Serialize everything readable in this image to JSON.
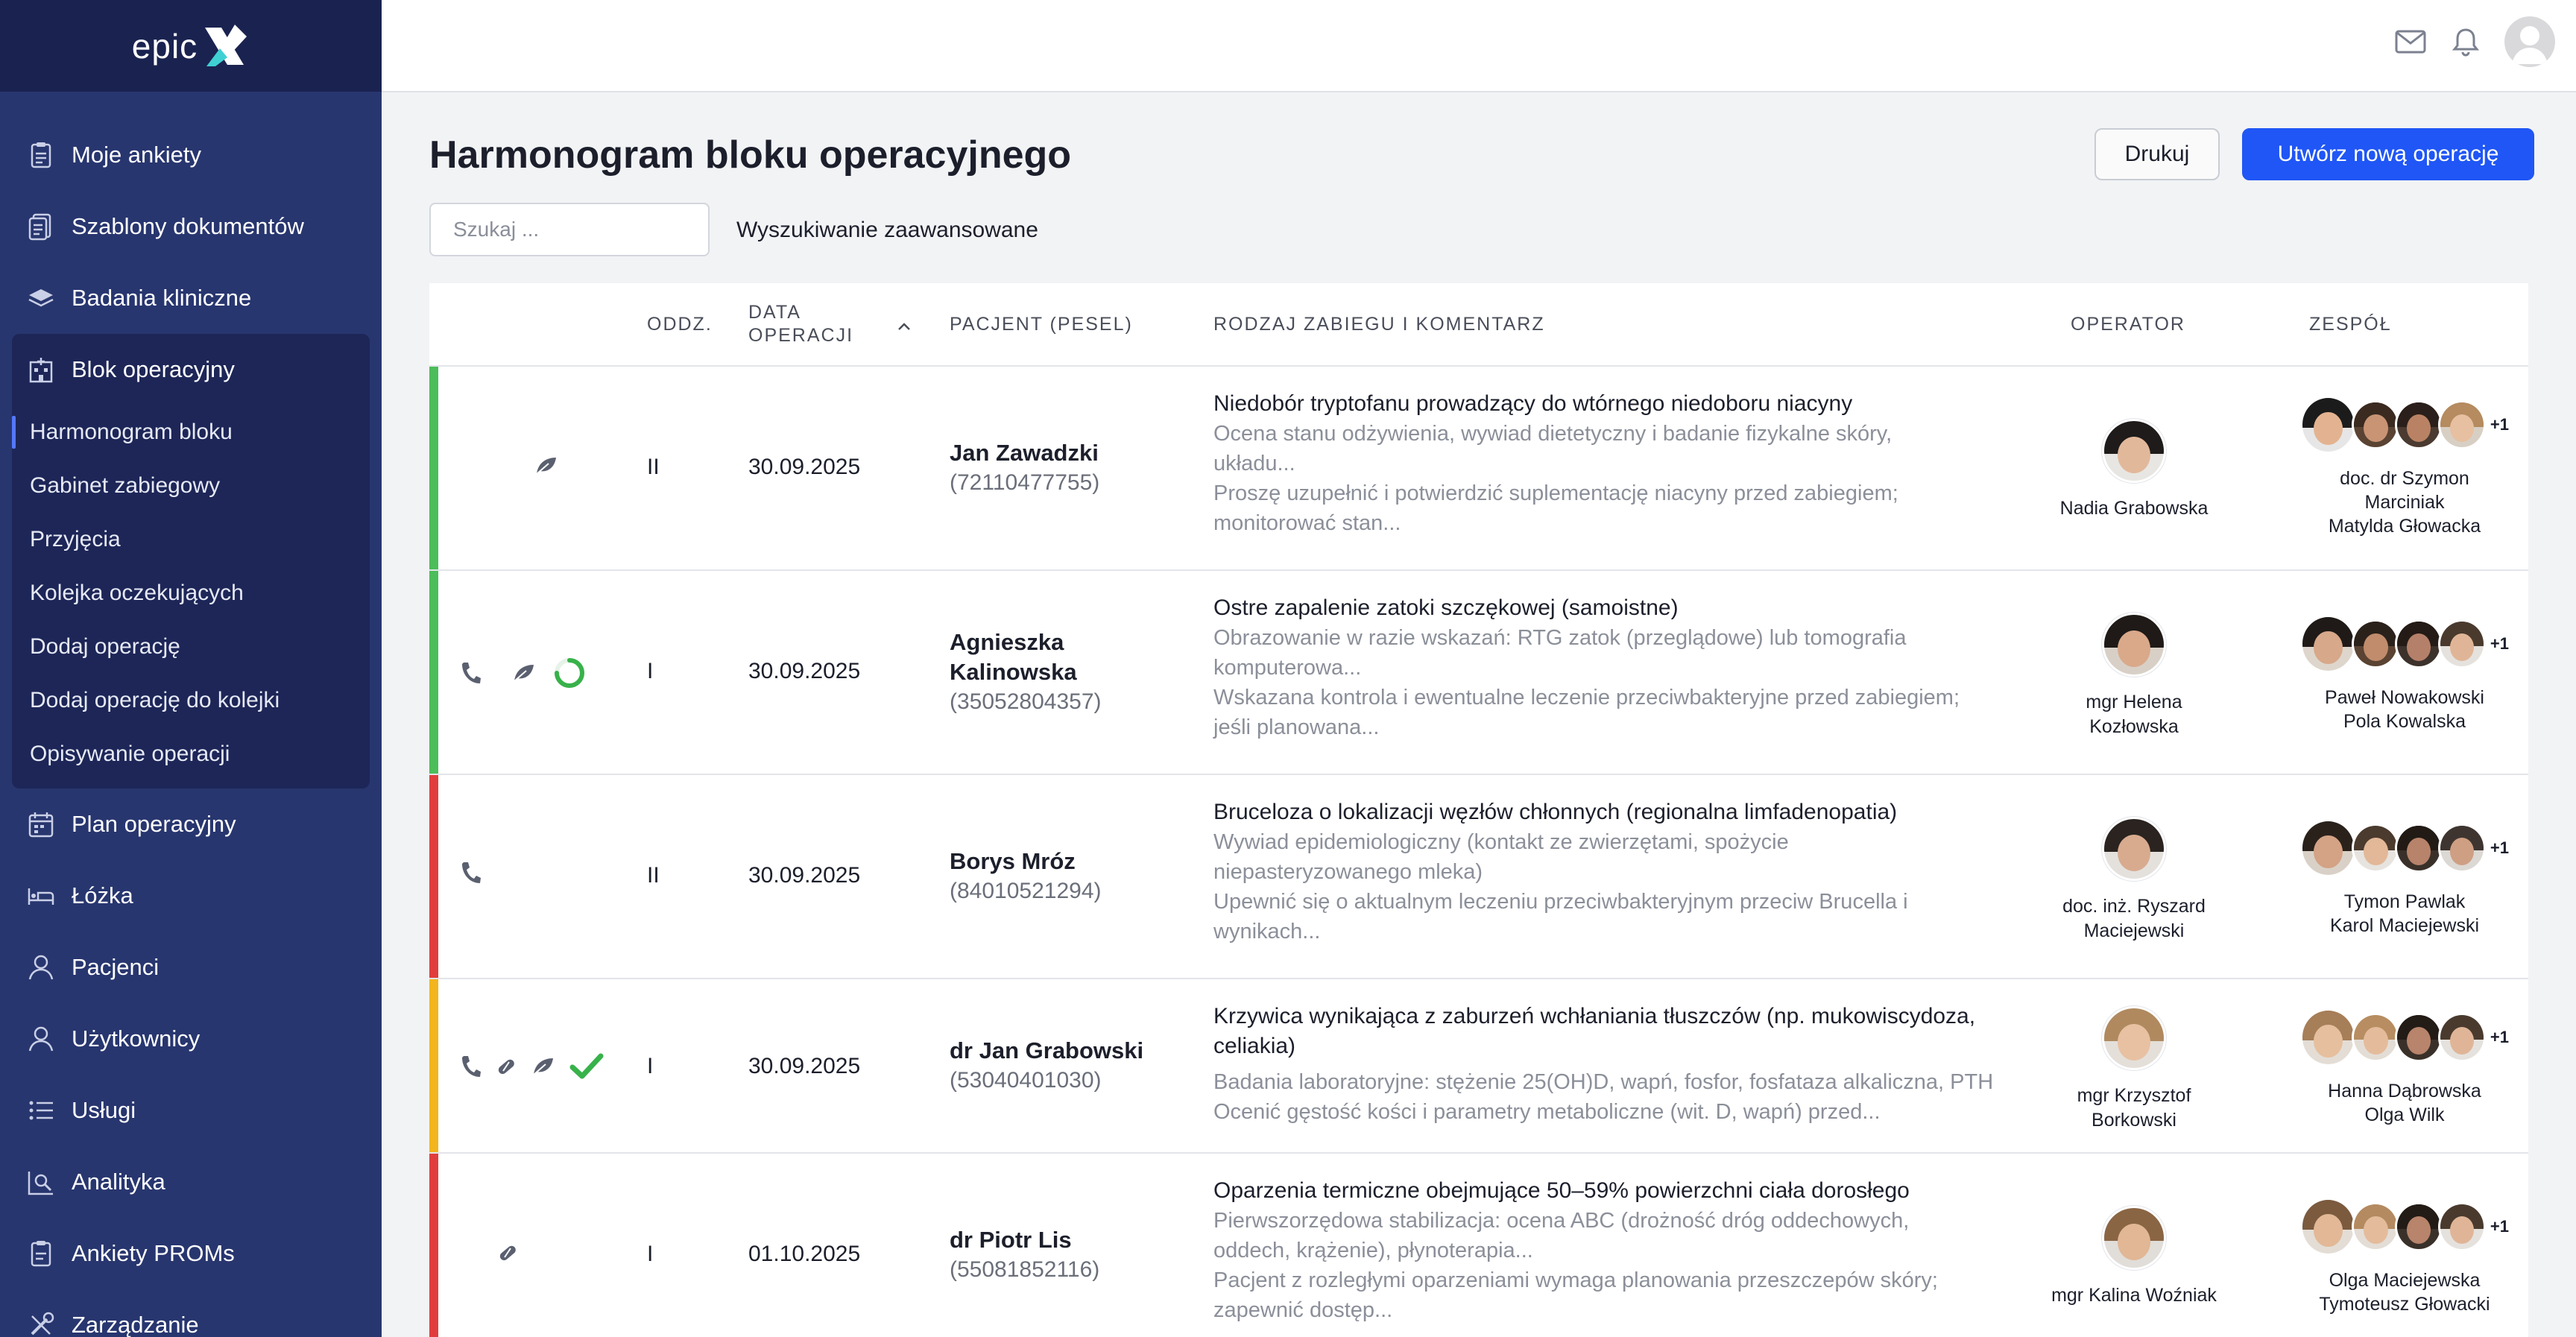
{
  "app": {
    "logo_text": "epic"
  },
  "colors": {
    "accent": "#1f56f5",
    "sidebar": "#28366f",
    "green": "#4cbd5a",
    "red": "#e23d3d",
    "yellow": "#f2b51d"
  },
  "sidebar": {
    "items_top": [
      {
        "label": "Moje ankiety",
        "icon": "clipboard-icon"
      },
      {
        "label": "Szablony dokumentów",
        "icon": "document-template-icon"
      },
      {
        "label": "Badania kliniczne",
        "icon": "layers-icon"
      }
    ],
    "group": {
      "label": "Blok operacyjny",
      "icon": "hospital-icon",
      "sub_items": [
        {
          "label": "Harmonogram bloku",
          "active": true
        },
        {
          "label": "Gabinet zabiegowy"
        },
        {
          "label": "Przyjęcia"
        },
        {
          "label": "Kolejka oczekujących"
        },
        {
          "label": "Dodaj operację"
        },
        {
          "label": "Dodaj operację do kolejki"
        },
        {
          "label": "Opisywanie operacji"
        }
      ]
    },
    "items_bottom": [
      {
        "label": "Plan operacyjny",
        "icon": "calendar-icon"
      },
      {
        "label": "Łóżka",
        "icon": "bed-icon"
      },
      {
        "label": "Pacjenci",
        "icon": "user-icon"
      },
      {
        "label": "Użytkownicy",
        "icon": "users-icon"
      },
      {
        "label": "Usługi",
        "icon": "list-icon"
      },
      {
        "label": "Analityka",
        "icon": "analytics-icon"
      },
      {
        "label": "Ankiety PROMs",
        "icon": "survey-icon"
      },
      {
        "label": "Zarządzanie",
        "icon": "tools-icon"
      }
    ]
  },
  "header": {
    "title": "Harmonogram bloku operacyjnego",
    "print_label": "Drukuj",
    "new_label": "Utwórz nową operację",
    "search_placeholder": "Szukaj ...",
    "advanced_search": "Wyszukiwanie zaawansowane"
  },
  "table": {
    "columns": {
      "dept": "ODDZ.",
      "date_line1": "DATA",
      "date_line2": "OPERACJI",
      "patient": "PACJENT (PESEL)",
      "procedure": "RODZAJ ZABIEGU I KOMENTARZ",
      "operator": "OPERATOR",
      "team": "ZESPÓŁ"
    },
    "rows": [
      {
        "status_color": "#4cbd5a",
        "icons": [
          "leaf-icon"
        ],
        "dept": "II",
        "date": "30.09.2025",
        "patient_name": "Jan Zawadzki",
        "pesel": "(72110477755)",
        "procedure_title": "Niedobór tryptofanu prowadzący do wtórnego niedoboru niacyny",
        "desc_lines": [
          "Ocena stanu odżywienia, wywiad dietetyczny i badanie fizykalne skóry,",
          "układu...",
          "Proszę uzupełnić i potwierdzić suplementację niacyny przed zabiegiem;",
          "monitorować stan..."
        ],
        "operator": [
          "Nadia Grabowska"
        ],
        "team_more": "+1",
        "team": [
          "doc. dr Szymon",
          "Marciniak",
          "Matylda Głowacka"
        ]
      },
      {
        "status_color": "#4cbd5a",
        "icons": [
          "phone-icon",
          "leaf-icon",
          "progress-ring-icon"
        ],
        "dept": "I",
        "date": "30.09.2025",
        "patient_name": "Agnieszka Kalinowska",
        "pesel": "(35052804357)",
        "procedure_title": "Ostre zapalenie zatoki szczękowej (samoistne)",
        "desc_lines": [
          "Obrazowanie w razie wskazań: RTG zatok (przeglądowe) lub tomografia",
          "komputerowa...",
          "Wskazana kontrola i ewentualne leczenie przeciwbakteryjne przed zabiegiem;",
          "jeśli planowana..."
        ],
        "operator": [
          "mgr Helena",
          "Kozłowska"
        ],
        "team_more": "+1",
        "team": [
          "Paweł Nowakowski",
          "Pola Kowalska"
        ]
      },
      {
        "status_color": "#e23d3d",
        "icons": [
          "phone-icon"
        ],
        "dept": "II",
        "date": "30.09.2025",
        "patient_name": "Borys Mróz",
        "pesel": "(84010521294)",
        "procedure_title": "Bruceloza o lokalizacji węzłów chłonnych (regionalna limfadenopatia)",
        "desc_lines": [
          "Wywiad epidemiologiczny (kontakt ze zwierzętami, spożycie",
          "niepasteryzowanego mleka)",
          "Upewnić się o aktualnym leczeniu przeciwbakteryjnym przeciw Brucella i",
          "wynikach..."
        ],
        "operator": [
          "doc. inż. Ryszard",
          "Maciejewski"
        ],
        "team_more": "+1",
        "team": [
          "Tymon Pawlak",
          "Karol Maciejewski"
        ]
      },
      {
        "status_color": "#f2b51d",
        "icons": [
          "phone-icon",
          "pill-icon",
          "leaf-icon",
          "check-icon"
        ],
        "dept": "I",
        "date": "30.09.2025",
        "patient_name": "dr Jan Grabowski",
        "pesel": "(53040401030)",
        "procedure_title": "Krzywica wynikająca z zaburzeń wchłaniania tłuszczów (np. mukowiscydoza,",
        "procedure_title2": "celiakia)",
        "desc_lines": [
          "Badania laboratoryjne: stężenie 25(OH)D, wapń, fosfor, fosfataza alkaliczna, PTH",
          "Ocenić gęstość kości i parametry metaboliczne (wit. D, wapń) przed..."
        ],
        "operator": [
          "mgr Krzysztof",
          "Borkowski"
        ],
        "team_more": "+1",
        "team": [
          "Hanna Dąbrowska",
          "Olga Wilk"
        ]
      },
      {
        "status_color": "#e23d3d",
        "icons": [
          "pill-icon"
        ],
        "dept": "I",
        "date": "01.10.2025",
        "patient_name": "dr Piotr Lis",
        "pesel": "(55081852116)",
        "procedure_title": "Oparzenia termiczne obejmujące 50–59% powierzchni ciała dorosłego",
        "desc_lines": [
          "Pierwszorzędowa stabilizacja: ocena ABC (drożność dróg oddechowych,",
          "oddech, krążenie), płynoterapia...",
          "Pacjent z rozległymi oparzeniami wymaga planowania przeszczepów skóry;",
          "zapewnić dostęp..."
        ],
        "operator": [
          "mgr Kalina Woźniak"
        ],
        "team_more": "+1",
        "team": [
          "Olga Maciejewska",
          "Tymoteusz Głowacki"
        ]
      }
    ]
  }
}
